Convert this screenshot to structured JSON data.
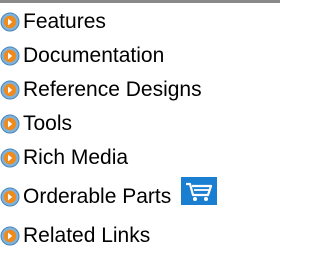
{
  "nav": {
    "items": [
      {
        "label": "Features",
        "icon": "orange-arrow-bullet-icon"
      },
      {
        "label": "Documentation",
        "icon": "orange-arrow-bullet-icon"
      },
      {
        "label": "Reference Designs",
        "icon": "orange-arrow-bullet-icon"
      },
      {
        "label": "Tools",
        "icon": "orange-arrow-bullet-icon"
      },
      {
        "label": "Rich Media",
        "icon": "orange-arrow-bullet-icon"
      },
      {
        "label": "Orderable Parts",
        "icon": "orange-arrow-bullet-icon",
        "extra_icon": "shopping-cart-icon"
      },
      {
        "label": "Related Links",
        "icon": "orange-arrow-bullet-icon"
      }
    ]
  },
  "colors": {
    "bullet_outer": "#5f9fd0",
    "bullet_inner": "#f08a1c",
    "cart_background": "#1a7fd1",
    "top_rule": "#8a8a8a"
  }
}
